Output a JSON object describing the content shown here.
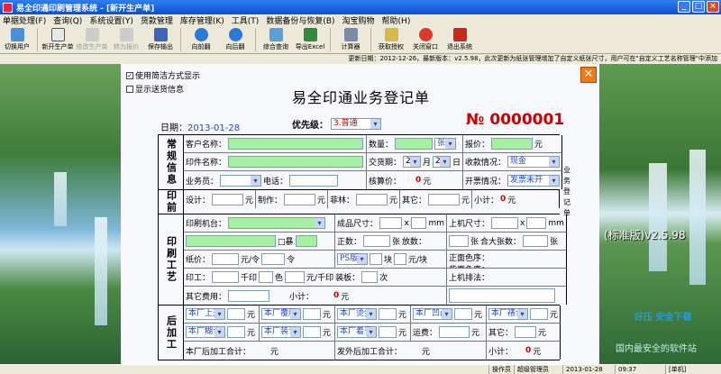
{
  "window": {
    "title": "易全印通印刷管理系统 - [新开生产单]"
  },
  "menu": [
    "单据处理(F)",
    "查询(Q)",
    "系统设置(Y)",
    "货款管理",
    "库存管理(K)",
    "工具(T)",
    "数据备份与恢复(B)",
    "淘宝购物",
    "帮助(H)"
  ],
  "toolbar": [
    {
      "label": "切换用户",
      "icon": "switch-user-icon",
      "enabled": true
    },
    {
      "label": "新开生产单",
      "icon": "new-order-icon",
      "enabled": true
    },
    {
      "label": "修改生产单",
      "icon": "edit-order-icon",
      "enabled": false
    },
    {
      "label": "转为报价",
      "icon": "convert-quote-icon",
      "enabled": false
    },
    {
      "label": "保存输出",
      "icon": "save-icon",
      "enabled": true
    },
    {
      "label": "向前翻",
      "icon": "prev-icon",
      "enabled": true
    },
    {
      "label": "向后翻",
      "icon": "next-icon",
      "enabled": true
    },
    {
      "label": "综合查询",
      "icon": "query-icon",
      "enabled": true
    },
    {
      "label": "导出Excel",
      "icon": "excel-icon",
      "enabled": true
    },
    {
      "label": "计算器",
      "icon": "calculator-icon",
      "enabled": true
    },
    {
      "label": "获取授权",
      "icon": "license-icon",
      "enabled": true
    },
    {
      "label": "关闭窗口",
      "icon": "close-window-icon",
      "enabled": true
    },
    {
      "label": "退出系统",
      "icon": "exit-icon",
      "enabled": true
    }
  ],
  "update_text": "更新日期：2012-12-26，最新版本：v2.5.98，此次更新为纸张管理增加了自定义纸张尺寸，用户可在\"自定义工艺名称管理\"中添加",
  "form": {
    "opt1": "使用简洁方式显示",
    "opt1_checked": "✓",
    "opt2": "显示送货信息",
    "title": "易全印通业务登记单",
    "date_label": "日期：",
    "date": "2013-01-28",
    "priority_label": "优先级：",
    "priority": "3.普通",
    "order_no": "№ 0000001",
    "side_note": "业务登记单",
    "sec_general": "常规信息",
    "sec_prepress": "印前",
    "sec_process": "印刷工艺",
    "sec_post": "后加工",
    "customer": "客户名称：",
    "qty": "数量：",
    "qty_unit": "张",
    "quote": "报价：",
    "yuan": "元",
    "print_name": "印件名称：",
    "due": "交货期：",
    "due_m": "2",
    "month": "月",
    "due_d": "2",
    "day": "日",
    "payment": "收款情况：",
    "payment_val": "现金",
    "sales": "业务员：",
    "phone": "电话：",
    "cost": "核算价：",
    "zero": "0",
    "invoice": "开票情况：",
    "invoice_val": "发票未开",
    "design": "设计：",
    "make": "制作：",
    "film": "菲林：",
    "other": "其它：",
    "subtotal": "小计：",
    "machine": "印刷机台：",
    "finish_size": "成品尺寸：",
    "x": "x",
    "mm": "mm",
    "machine_size": "上机尺寸：",
    "bleed": "□暴",
    "sheets": "正数：",
    "zhang": "张",
    "extra": "放数：",
    "total_sheets": "合大张数：",
    "paper_price": "纸价：",
    "per_ream": "元/令",
    "ling": "令",
    "ps": "PS版",
    "kuai": "块",
    "per_kuai": "元/块",
    "front_color": "正面色序：",
    "back_color": "背面色序：",
    "print_work": "印工：",
    "thousand": "千印",
    "color": "色",
    "per_thousand": "元/千印",
    "plate": "装板：",
    "times": "次",
    "plate_note": "上机排法：",
    "other_fee": "其它费用：",
    "post_items": [
      "本厂上光",
      "本厂覆膜",
      "本厂烫金",
      "本厂凹凸",
      "本厂裱合",
      "本厂糊合",
      "本厂装订",
      "本厂着号"
    ],
    "freight": "运费：",
    "in_house_total": "本厂后加工合计：",
    "out_total": "发外后加工合计："
  },
  "version": "(标准版)v2.5.98",
  "watermark1": "好压 安全下载",
  "watermark2": "国内最安全的软件站",
  "status": {
    "operator_label": "操作员",
    "operator": "超级管理员",
    "date": "2013-01-28",
    "time": "09:37",
    "mode": "[单机]"
  }
}
